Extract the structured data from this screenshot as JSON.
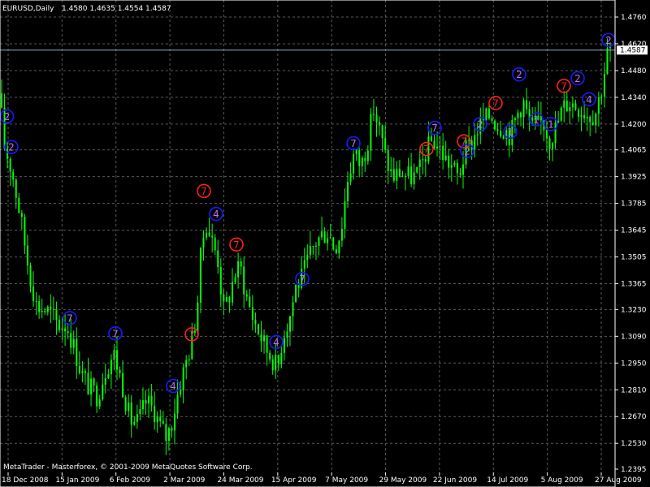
{
  "header": {
    "symbol_label": "EURUSD,Daily",
    "ohlc_label": "1.4580 1.4635 1.4554 1.4587"
  },
  "footer": {
    "copyright": "MetaTrader - Masterforex, © 2001-2009 MetaQuotes Software Corp."
  },
  "current_price_label": "1.4587",
  "colors": {
    "background": "#000000",
    "candle": "#00ff00",
    "grid": "#5a5a5a",
    "axis": "#ffffff",
    "price_line": "#8fb4c8",
    "marker_red": "#ff2020",
    "marker_blue": "#1a1aff",
    "marker_purple": "#c070ff"
  },
  "chart_data": {
    "type": "candlestick",
    "y_ticks": [
      "1.4760",
      "1.4620",
      "1.4480",
      "1.4340",
      "1.4200",
      "1.4065",
      "1.3925",
      "1.3785",
      "1.3645",
      "1.3505",
      "1.3365",
      "1.3230",
      "1.3090",
      "1.2950",
      "1.2810",
      "1.2670",
      "1.2530",
      "1.2395"
    ],
    "ylim": [
      1.2395,
      1.476
    ],
    "x_ticks": [
      "18 Dec 2008",
      "15 Jan 2009",
      "6 Feb 2009",
      "2 Mar 2009",
      "24 Mar 2009",
      "15 Apr 2009",
      "7 May 2009",
      "29 May 2009",
      "22 Jun 2009",
      "14 Jul 2009",
      "5 Aug 2009",
      "27 Aug 2009"
    ],
    "current_price": 1.4587,
    "grid": true,
    "path_points": [
      [
        0,
        1.448
      ],
      [
        3,
        1.412
      ],
      [
        8,
        1.405
      ],
      [
        15,
        1.395
      ],
      [
        25,
        1.372
      ],
      [
        35,
        1.345
      ],
      [
        45,
        1.325
      ],
      [
        60,
        1.322
      ],
      [
        72,
        1.315
      ],
      [
        82,
        1.315
      ],
      [
        90,
        1.305
      ],
      [
        100,
        1.29
      ],
      [
        110,
        1.282
      ],
      [
        120,
        1.278
      ],
      [
        130,
        1.292
      ],
      [
        140,
        1.3
      ],
      [
        150,
        1.285
      ],
      [
        160,
        1.265
      ],
      [
        170,
        1.264
      ],
      [
        180,
        1.275
      ],
      [
        190,
        1.27
      ],
      [
        197,
        1.262
      ],
      [
        205,
        1.256
      ],
      [
        212,
        1.265
      ],
      [
        220,
        1.282
      ],
      [
        228,
        1.294
      ],
      [
        235,
        1.305
      ],
      [
        242,
        1.32
      ],
      [
        247,
        1.35
      ],
      [
        253,
        1.37
      ],
      [
        260,
        1.36
      ],
      [
        268,
        1.35
      ],
      [
        275,
        1.322
      ],
      [
        282,
        1.33
      ],
      [
        289,
        1.342
      ],
      [
        296,
        1.345
      ],
      [
        303,
        1.33
      ],
      [
        312,
        1.318
      ],
      [
        320,
        1.31
      ],
      [
        328,
        1.302
      ],
      [
        336,
        1.297
      ],
      [
        342,
        1.292
      ],
      [
        348,
        1.31
      ],
      [
        356,
        1.318
      ],
      [
        364,
        1.335
      ],
      [
        372,
        1.34
      ],
      [
        380,
        1.35
      ],
      [
        388,
        1.358
      ],
      [
        396,
        1.362
      ],
      [
        404,
        1.364
      ],
      [
        412,
        1.355
      ],
      [
        420,
        1.365
      ],
      [
        428,
        1.392
      ],
      [
        436,
        1.405
      ],
      [
        444,
        1.398
      ],
      [
        452,
        1.41
      ],
      [
        460,
        1.428
      ],
      [
        468,
        1.415
      ],
      [
        476,
        1.4
      ],
      [
        484,
        1.392
      ],
      [
        492,
        1.395
      ],
      [
        500,
        1.393
      ],
      [
        508,
        1.392
      ],
      [
        516,
        1.395
      ],
      [
        524,
        1.405
      ],
      [
        532,
        1.412
      ],
      [
        540,
        1.408
      ],
      [
        548,
        1.402
      ],
      [
        556,
        1.398
      ],
      [
        564,
        1.392
      ],
      [
        572,
        1.405
      ],
      [
        580,
        1.41
      ],
      [
        588,
        1.418
      ],
      [
        596,
        1.422
      ],
      [
        604,
        1.425
      ],
      [
        612,
        1.42
      ],
      [
        620,
        1.418
      ],
      [
        628,
        1.414
      ],
      [
        636,
        1.425
      ],
      [
        644,
        1.432
      ],
      [
        652,
        1.42
      ],
      [
        660,
        1.418
      ],
      [
        668,
        1.422
      ],
      [
        676,
        1.412
      ],
      [
        684,
        1.418
      ],
      [
        692,
        1.428
      ],
      [
        700,
        1.432
      ],
      [
        708,
        1.43
      ],
      [
        716,
        1.428
      ],
      [
        724,
        1.425
      ],
      [
        732,
        1.425
      ],
      [
        740,
        1.438
      ],
      [
        748,
        1.458
      ],
      [
        752,
        1.459
      ]
    ],
    "markers": [
      {
        "d": "2",
        "c": "blue",
        "x": 0.5,
        "p": 1.424
      },
      {
        "d": "2",
        "c": "blue",
        "x": 6,
        "p": 1.408
      },
      {
        "d": "7",
        "c": "blue",
        "x": 78,
        "p": 1.3185
      },
      {
        "d": "7",
        "c": "blue",
        "x": 134,
        "p": 1.3105
      },
      {
        "d": "4",
        "c": "blue",
        "x": 205,
        "p": 1.283
      },
      {
        "d": "7",
        "c": "red",
        "x": 228,
        "p": 1.31
      },
      {
        "d": "7",
        "c": "red",
        "x": 243,
        "p": 1.385
      },
      {
        "d": "4",
        "c": "blue",
        "x": 258,
        "p": 1.373
      },
      {
        "d": "7",
        "c": "red",
        "x": 283,
        "p": 1.357
      },
      {
        "d": "4",
        "c": "blue",
        "x": 332,
        "p": 1.306
      },
      {
        "d": "7",
        "c": "blue",
        "x": 364,
        "p": 1.339
      },
      {
        "d": "7",
        "c": "blue",
        "x": 427,
        "p": 1.41
      },
      {
        "d": "7",
        "c": "red",
        "x": 517,
        "p": 1.407
      },
      {
        "d": "7",
        "c": "blue",
        "x": 527,
        "p": 1.418
      },
      {
        "d": "7",
        "c": "red",
        "x": 563,
        "p": 1.411
      },
      {
        "d": "2",
        "c": "blue",
        "x": 567,
        "p": 1.406
      },
      {
        "d": "2",
        "c": "blue",
        "x": 583,
        "p": 1.42
      },
      {
        "d": "7",
        "c": "red",
        "x": 602,
        "p": 1.431
      },
      {
        "d": "1",
        "c": "blue",
        "x": 620,
        "p": 1.416
      },
      {
        "d": "2",
        "c": "blue",
        "x": 631,
        "p": 1.446
      },
      {
        "d": "1",
        "c": "blue",
        "x": 652,
        "p": 1.4225
      },
      {
        "d": "1",
        "c": "blue",
        "x": 670,
        "p": 1.42
      },
      {
        "d": "7",
        "c": "red",
        "x": 686,
        "p": 1.44
      },
      {
        "d": "2",
        "c": "blue",
        "x": 703,
        "p": 1.444
      },
      {
        "d": "4",
        "c": "blue",
        "x": 717,
        "p": 1.433
      },
      {
        "d": "2",
        "c": "blue",
        "x": 741,
        "p": 1.464
      }
    ]
  }
}
